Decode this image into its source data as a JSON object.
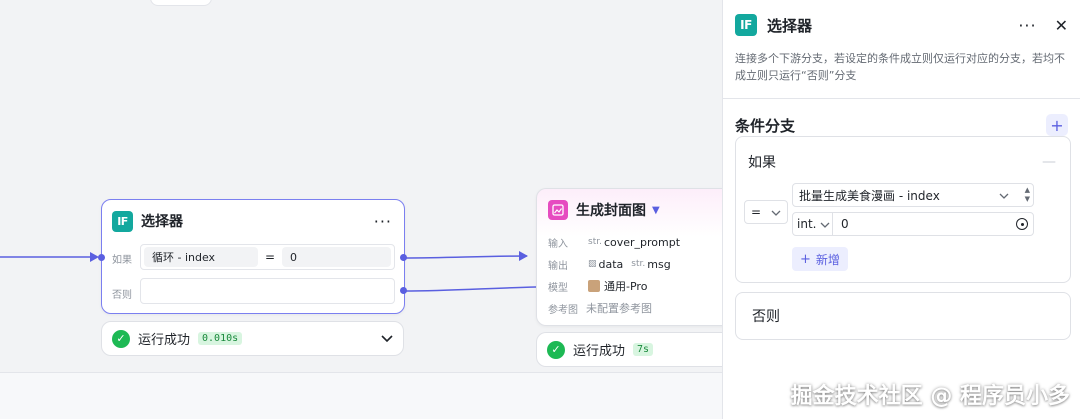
{
  "selector_node": {
    "icon_text": "IF",
    "title": "选择器",
    "more": "···",
    "if_label": "如果",
    "else_label": "否则",
    "left_operand": "循环 - index",
    "operator": "=",
    "right_operand": "0",
    "status": "运行成功",
    "time": "0.010s"
  },
  "cover_node": {
    "title": "生成封面图",
    "input_label": "输入",
    "input_tag": "str.",
    "input_value": "cover_prompt",
    "output_label": "输出",
    "output_value_1": "data",
    "output_tag_2": "str.",
    "output_value_2": "msg",
    "model_label": "模型",
    "model_value": "通用-Pro",
    "ref_label": "参考图",
    "ref_value": "未配置参考图",
    "status": "运行成功",
    "time": "7s"
  },
  "panel": {
    "icon_text": "IF",
    "title": "选择器",
    "more": "···",
    "close": "✕",
    "description": "连接多个下游分支，若设定的条件成立则仅运行对应的分支，若均不成立则只运行“否则”分支",
    "section_title": "条件分支",
    "add_symbol": "+",
    "if_title": "如果",
    "operator": "=",
    "left_value": "批量生成美食漫画 - index",
    "type_value": "int.",
    "right_value": "0",
    "add_label": "新增",
    "else_title": "否则"
  },
  "watermark": "掘金技术社区 @ 程序员小多",
  "colors": {
    "accent": "#5a5fe0",
    "if_icon": "#13a89e",
    "success": "#1db954",
    "cover_icon": "#e64bc0"
  }
}
